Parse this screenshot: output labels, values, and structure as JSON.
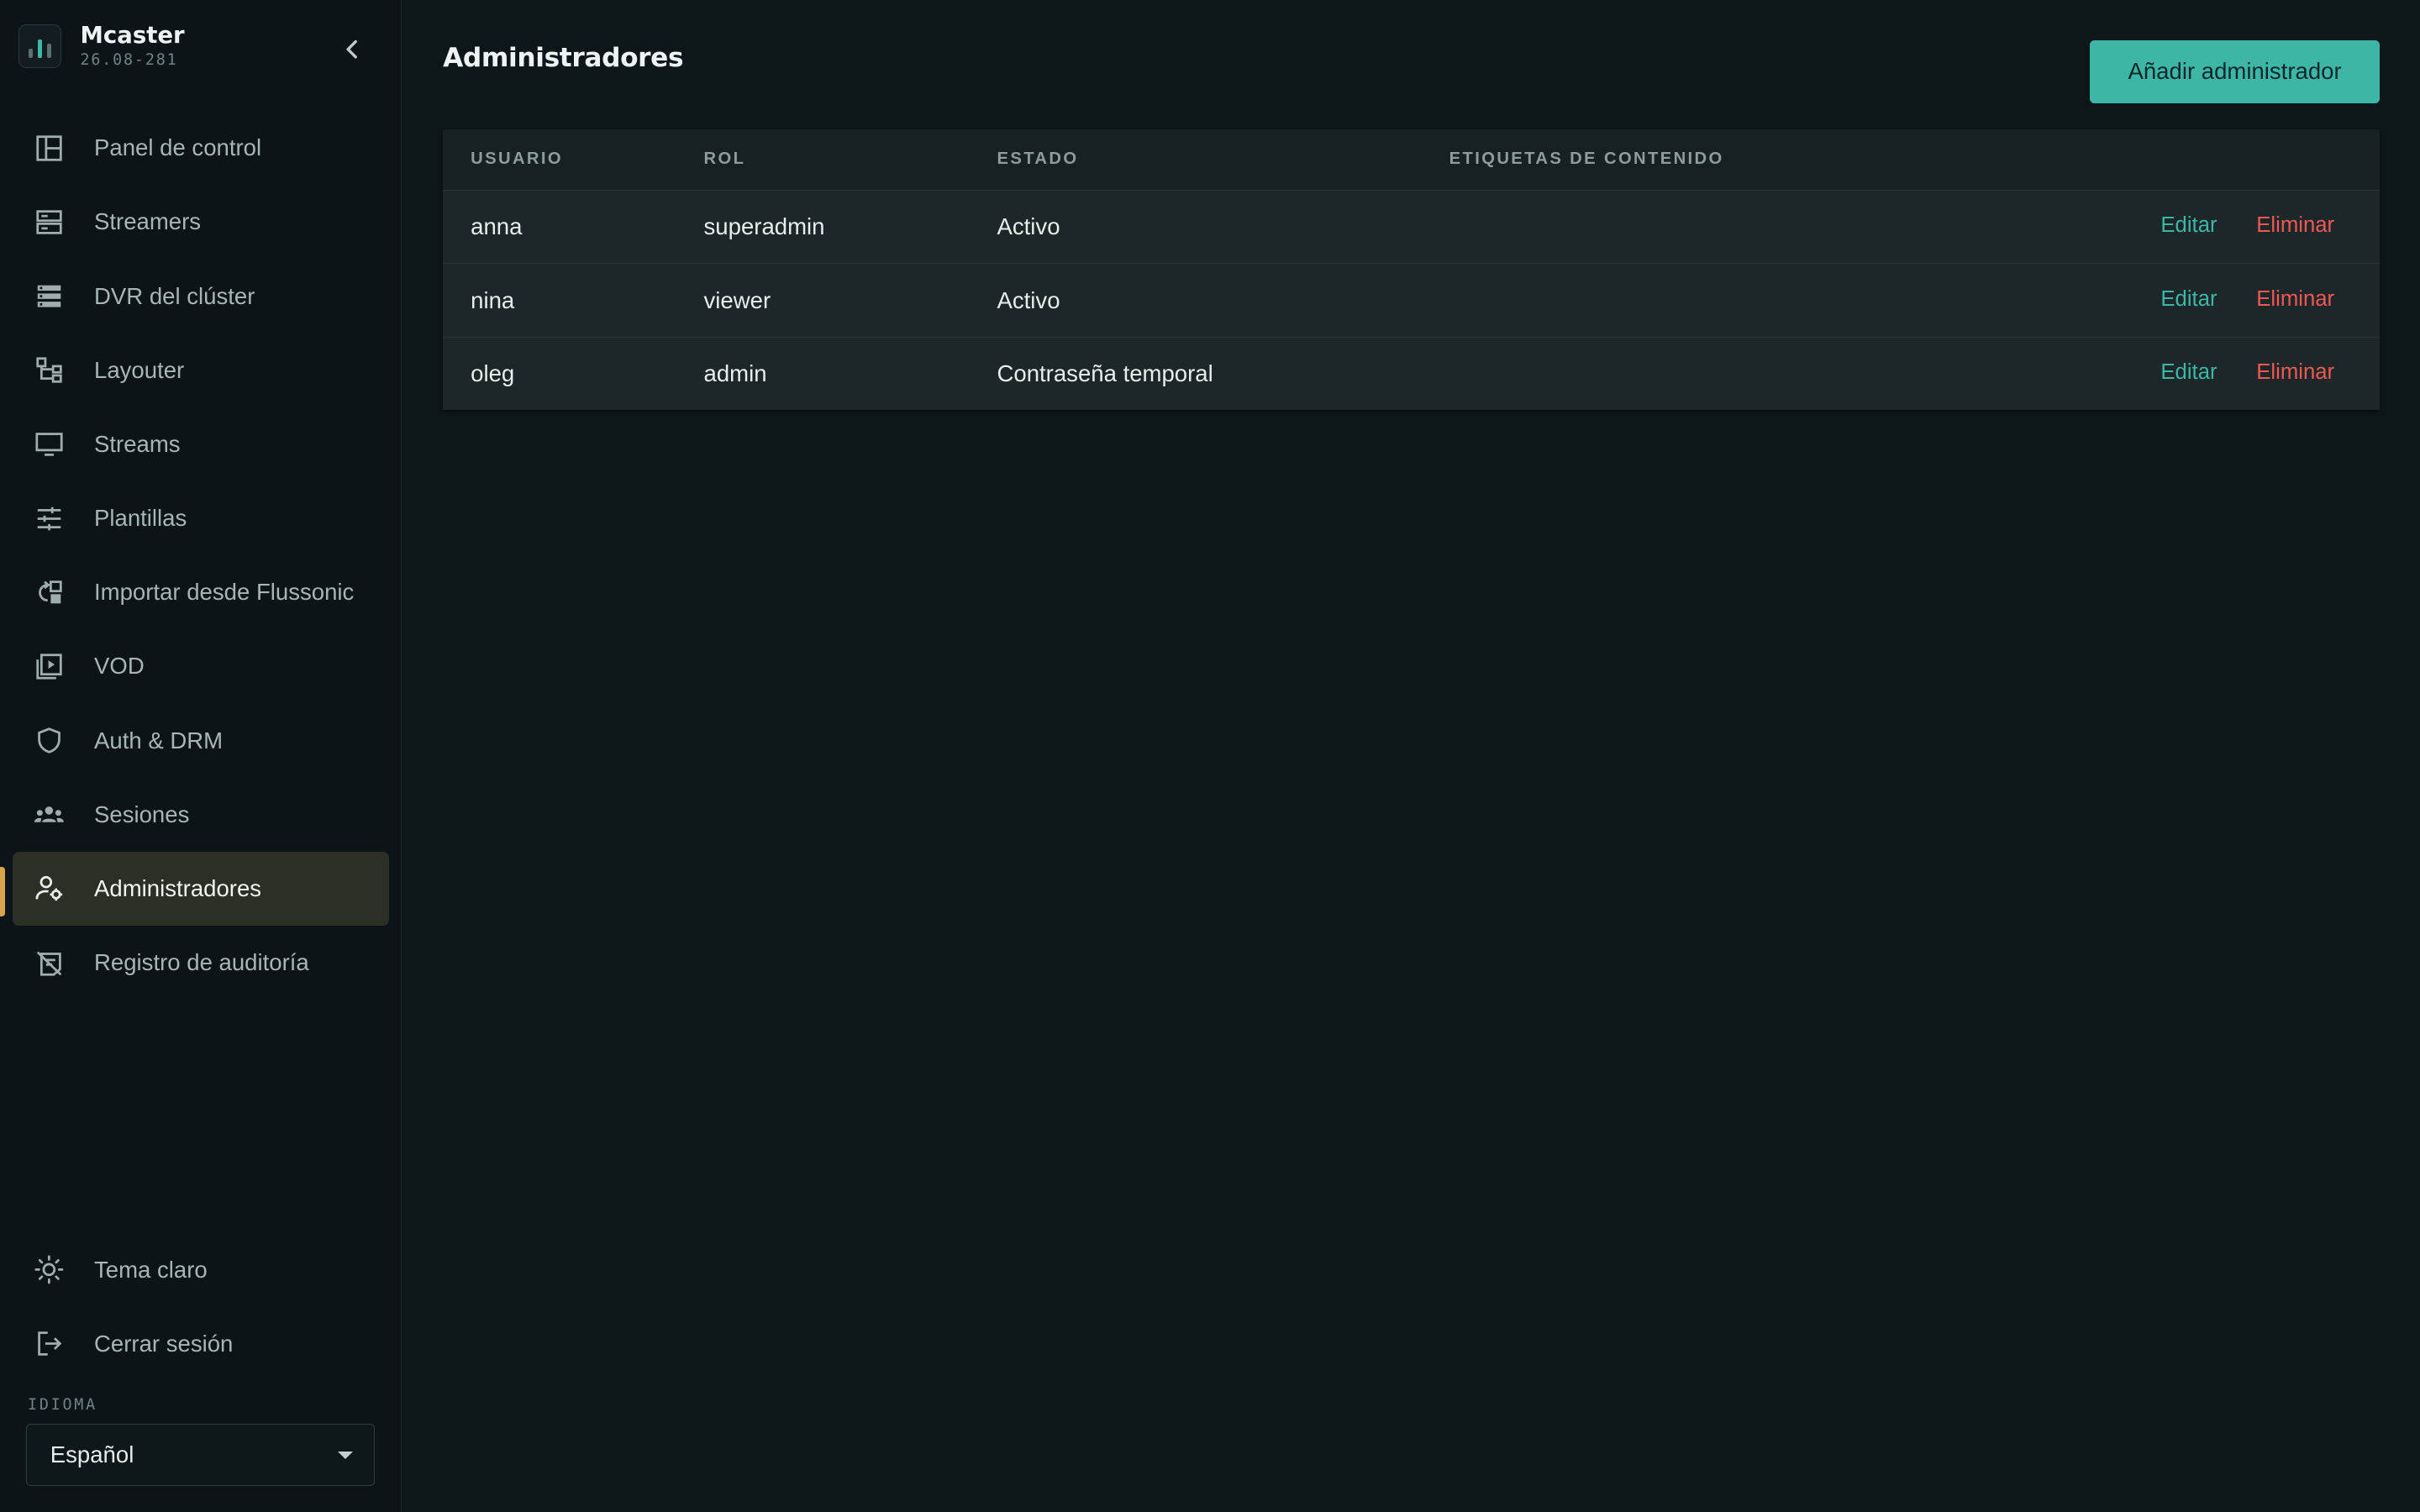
{
  "app": {
    "name": "Mcaster",
    "version": "26.08-281"
  },
  "sidebar": {
    "items": [
      {
        "label": "Panel de control",
        "icon": "dashboard-icon"
      },
      {
        "label": "Streamers",
        "icon": "server-icon"
      },
      {
        "label": "DVR del clúster",
        "icon": "storage-icon"
      },
      {
        "label": "Layouter",
        "icon": "layout-tree-icon"
      },
      {
        "label": "Streams",
        "icon": "monitor-icon"
      },
      {
        "label": "Plantillas",
        "icon": "sliders-icon"
      },
      {
        "label": "Importar desde Flussonic",
        "icon": "import-icon"
      },
      {
        "label": "VOD",
        "icon": "video-library-icon"
      },
      {
        "label": "Auth & DRM",
        "icon": "shield-icon"
      },
      {
        "label": "Sesiones",
        "icon": "users-icon"
      },
      {
        "label": "Administradores",
        "icon": "user-gear-icon",
        "active": true
      },
      {
        "label": "Registro de auditoría",
        "icon": "audit-icon"
      }
    ],
    "bottom": [
      {
        "label": "Tema claro",
        "icon": "sun-icon"
      },
      {
        "label": "Cerrar sesión",
        "icon": "logout-icon"
      }
    ],
    "language": {
      "label": "IDIOMA",
      "value": "Español"
    }
  },
  "main": {
    "title": "Administradores",
    "add_button": "Añadir administrador",
    "table": {
      "headers": [
        "USUARIO",
        "ROL",
        "ESTADO",
        "ETIQUETAS DE CONTENIDO"
      ],
      "rows": [
        {
          "user": "anna",
          "role": "superadmin",
          "status": "Activo",
          "tags": ""
        },
        {
          "user": "nina",
          "role": "viewer",
          "status": "Activo",
          "tags": ""
        },
        {
          "user": "oleg",
          "role": "admin",
          "status": "Contraseña temporal",
          "tags": ""
        }
      ],
      "actions": {
        "edit": "Editar",
        "delete": "Eliminar"
      }
    }
  },
  "colors": {
    "accent": "#3db5a7",
    "danger": "#ee5a52",
    "active_marker": "#d9a44b",
    "background": "#0d1619"
  }
}
